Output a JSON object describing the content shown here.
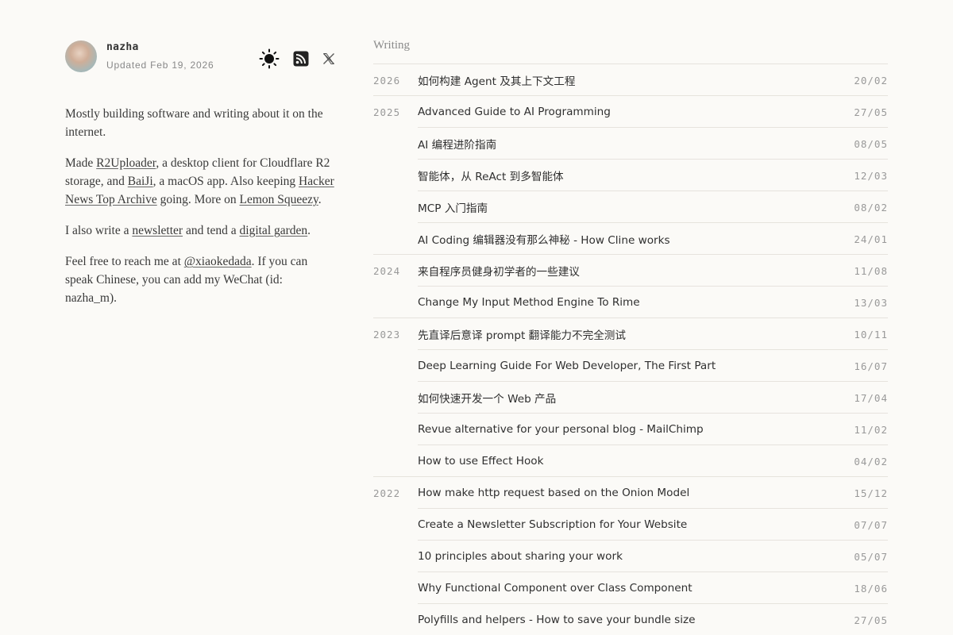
{
  "profile": {
    "name": "nazha",
    "updated": "Updated Feb 19, 2026"
  },
  "icons": {
    "theme": "sun-icon",
    "rss": "rss-icon",
    "social": "x-icon"
  },
  "intro": {
    "p1": "Mostly building software and writing about it on the internet.",
    "p2": {
      "t1": "Made ",
      "link1": "R2Uploader",
      "t2": ", a desktop client for Cloudflare R2 storage, and ",
      "link2": "BaiJi",
      "t3": ", a macOS app. Also keeping ",
      "link3": "Hacker News Top Archive",
      "t4": " going. More on ",
      "link4": "Lemon Squeezy",
      "t5": "."
    },
    "p3": {
      "t1": "I also write a ",
      "link1": "newsletter",
      "t2": " and tend a ",
      "link2": "digital garden",
      "t3": "."
    },
    "p4": {
      "t1": "Feel free to reach me at ",
      "link1": "@xiaokedada",
      "t2": ". If you can speak Chinese, you can add my WeChat (id: nazha_m)."
    }
  },
  "writing": {
    "title": "Writing",
    "posts": [
      {
        "year": "2026",
        "title": "如何构建 Agent 及其上下文工程",
        "date": "20/02"
      },
      {
        "year": "2025",
        "title": "Advanced Guide to AI Programming",
        "date": "27/05"
      },
      {
        "year": "",
        "title": "AI 编程进阶指南",
        "date": "08/05"
      },
      {
        "year": "",
        "title": "智能体，从 ReAct 到多智能体",
        "date": "12/03"
      },
      {
        "year": "",
        "title": "MCP 入门指南",
        "date": "08/02"
      },
      {
        "year": "",
        "title": "AI Coding 编辑器没有那么神秘 - How Cline works",
        "date": "24/01"
      },
      {
        "year": "2024",
        "title": "来自程序员健身初学者的一些建议",
        "date": "11/08"
      },
      {
        "year": "",
        "title": "Change My Input Method Engine To Rime",
        "date": "13/03"
      },
      {
        "year": "2023",
        "title": "先直译后意译 prompt 翻译能力不完全测试",
        "date": "10/11"
      },
      {
        "year": "",
        "title": "Deep Learning Guide For Web Developer, The First Part",
        "date": "16/07"
      },
      {
        "year": "",
        "title": "如何快速开发一个 Web 产品",
        "date": "17/04"
      },
      {
        "year": "",
        "title": "Revue alternative for your personal blog - MailChimp",
        "date": "11/02"
      },
      {
        "year": "",
        "title": "How to use Effect Hook",
        "date": "04/02"
      },
      {
        "year": "2022",
        "title": "How make http request based on the Onion Model",
        "date": "15/12"
      },
      {
        "year": "",
        "title": "Create a Newsletter Subscription for Your Website",
        "date": "07/07"
      },
      {
        "year": "",
        "title": "10 principles about sharing your work",
        "date": "05/07"
      },
      {
        "year": "",
        "title": "Why Functional Component over Class Component",
        "date": "18/06"
      },
      {
        "year": "",
        "title": "Polyfills and helpers - How to save your bundle size",
        "date": "27/05"
      }
    ]
  }
}
